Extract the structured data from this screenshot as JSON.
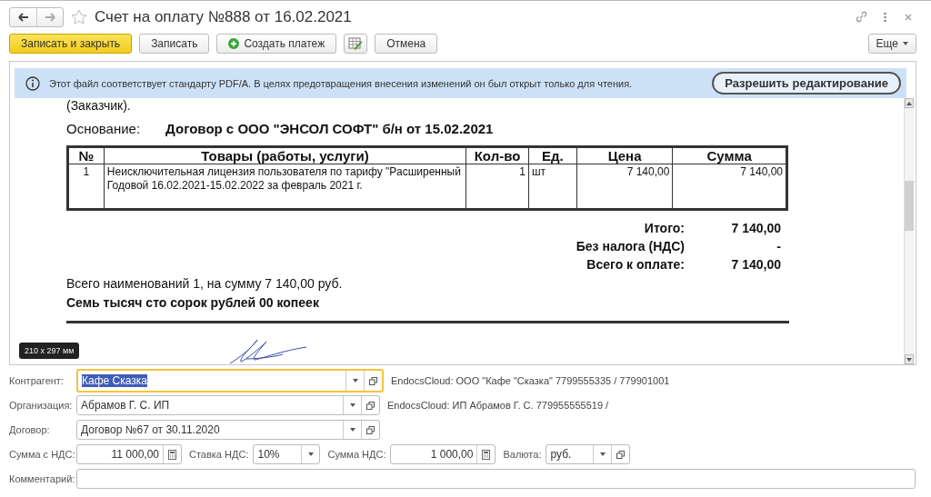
{
  "window": {
    "title": "Счет на оплату №888 от 16.02.2021"
  },
  "toolbar": {
    "buttons": [
      {
        "kind": "primary",
        "label": "Записать и закрыть"
      },
      {
        "kind": "plain",
        "label": "Записать"
      },
      {
        "kind": "add",
        "label": "Создать платеж"
      },
      {
        "kind": "icon"
      },
      {
        "kind": "plain",
        "label": "Отмена"
      }
    ],
    "more": "Еще"
  },
  "banner": {
    "text": "Этот файл соответствует стандарту PDF/A. В целях предотвращения внесения изменений он был открыт только для чтения.",
    "button": "Разрешить редактирование"
  },
  "document": {
    "preamble": "(Заказчик).",
    "basis_label": "Основание:",
    "basis": "Договор с ООО \"ЭНСОЛ СОФТ\" б/н от 15.02.2021",
    "table": {
      "columns": [
        "№",
        "Товары (работы, услуги)",
        "Кол-во",
        "Ед.",
        "Цена",
        "Сумма"
      ],
      "rows": [
        [
          "1",
          "Неисключительная лицензия пользователя по тарифу \"Расширенный Годовой 16.02.2021-15.02.2022 за февраль 2021 г.",
          "1",
          "шт",
          "7 140,00",
          "7 140,00"
        ]
      ]
    },
    "totals": [
      {
        "label": "Итого:",
        "value": "7 140,00"
      },
      {
        "label": "Без налога (НДС)",
        "value": "-"
      },
      {
        "label": "Всего к оплате:",
        "value": "7 140,00"
      }
    ],
    "summary": "Всего наименований 1, на сумму 7 140,00 руб.",
    "amount_words": "Семь тысяч сто сорок рублей 00 копеек",
    "size_badge": "210 x 297 мм"
  },
  "form": [
    {
      "fields": [
        {
          "label": "Контрагент:",
          "kind": "select",
          "value": "Кафе Сказка",
          "focused": true
        }
      ],
      "info": "EndocsCloud: ООО \"Кафе \"Сказка\" 7799555335 / 779901001"
    },
    {
      "fields": [
        {
          "label": "Организация:",
          "kind": "select",
          "value": "Абрамов Г. С. ИП",
          "focused": false
        }
      ],
      "info": "EndocsCloud: ИП Абрамов Г. С. 779955555519 /"
    },
    {
      "fields": [
        {
          "label": "Договор:",
          "kind": "select",
          "value": "Договор №67 от 30.11.2020",
          "focused": false
        }
      ]
    },
    {
      "fields": [
        {
          "label": "Сумма с НДС:",
          "kind": "number",
          "value": "11 000,00",
          "focused": false
        },
        {
          "label": "Ставка НДС:",
          "kind": "dropdown",
          "value": "10%",
          "focused": false
        },
        {
          "label": "Сумма НДС:",
          "kind": "number",
          "value": "1 000,00",
          "focused": false
        },
        {
          "label": "Валюта:",
          "kind": "select",
          "value": "руб.",
          "focused": false
        }
      ]
    },
    {
      "fields": [
        {
          "label": "Комментарий:",
          "kind": "text",
          "focused": false
        }
      ]
    }
  ]
}
